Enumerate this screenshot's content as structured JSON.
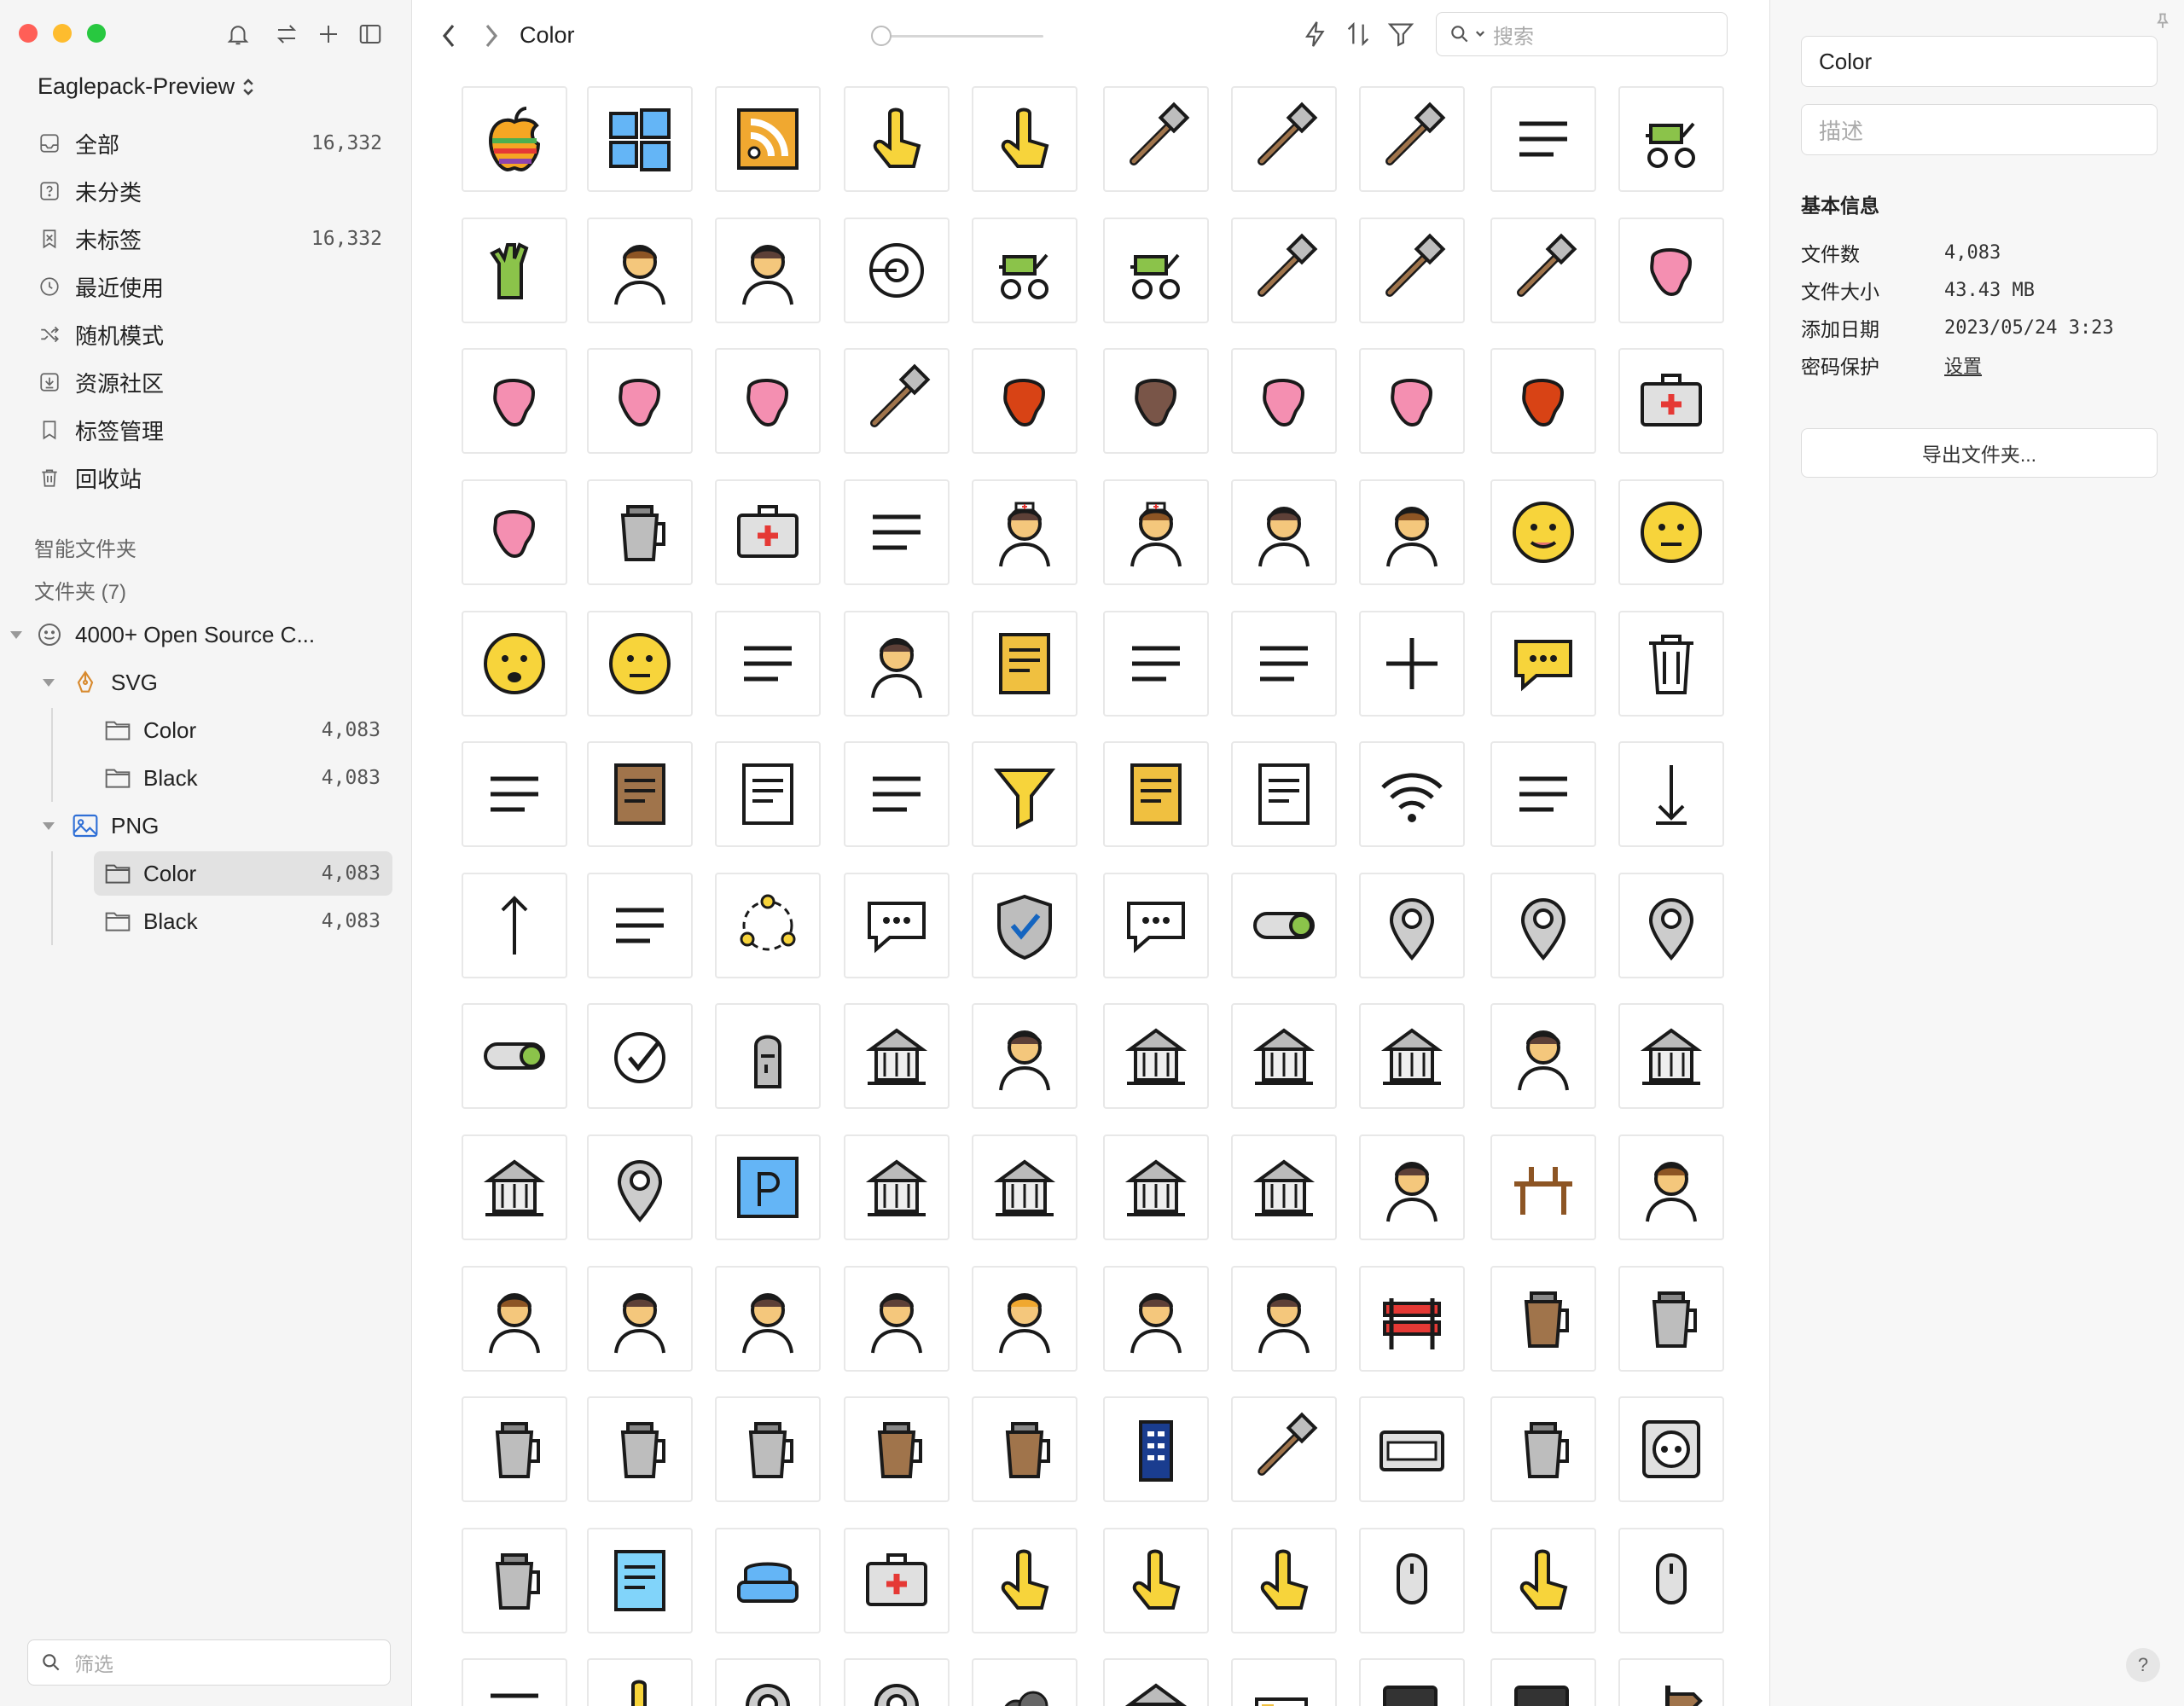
{
  "library": {
    "name": "Eaglepack-Preview"
  },
  "nav": [
    {
      "label": "全部",
      "count": "16,332",
      "icon": "inbox-icon"
    },
    {
      "label": "未分类",
      "count": "",
      "icon": "question-box-icon"
    },
    {
      "label": "未标签",
      "count": "16,332",
      "icon": "untagged-icon"
    },
    {
      "label": "最近使用",
      "count": "",
      "icon": "clock-icon"
    },
    {
      "label": "随机模式",
      "count": "",
      "icon": "shuffle-icon"
    },
    {
      "label": "资源社区",
      "count": "",
      "icon": "download-box-icon"
    },
    {
      "label": "标签管理",
      "count": "",
      "icon": "bookmark-icon"
    },
    {
      "label": "回收站",
      "count": "",
      "icon": "trash-icon"
    }
  ],
  "sections": {
    "smart_folders": "智能文件夹",
    "folders": "文件夹 (7)"
  },
  "tree": {
    "root": {
      "label": "4000+ Open Source C..."
    },
    "svg": {
      "label": "SVG",
      "children": [
        {
          "label": "Color",
          "count": "4,083"
        },
        {
          "label": "Black",
          "count": "4,083"
        }
      ]
    },
    "png": {
      "label": "PNG",
      "children": [
        {
          "label": "Color",
          "count": "4,083"
        },
        {
          "label": "Black",
          "count": "4,083"
        }
      ]
    }
  },
  "filter": {
    "placeholder": "筛选"
  },
  "toolbar": {
    "breadcrumb": "Color",
    "search_placeholder": "搜索"
  },
  "colors": {
    "accent": "#2f6fd6",
    "close": "#ff5f57",
    "minimize": "#febc2e",
    "zoom": "#28c840",
    "emoji_yellow": "#f7d43b",
    "skin": "#f4c77c"
  },
  "icons": [
    "apple-logo-icon",
    "windows-logo-icon",
    "rss-feed-icon",
    "no-handshake-icon",
    "hand-saw-icon",
    "axe-icon",
    "trowel-icon",
    "shovel-icon",
    "wheelbarrow-icon",
    "lawn-mower-icon",
    "gardening-gloves-icon",
    "woman-farmer-icon",
    "man-farmer-icon",
    "radiology-icon",
    "stretcher-icon",
    "wheelchair-icon",
    "crutches-icon",
    "scissors-icon",
    "thermometer-icon",
    "broken-bone-icon",
    "pelvis-pain-icon",
    "leg-pain-icon",
    "brain-icon",
    "tweezers-icon",
    "kidney-icon",
    "intestine-icon",
    "colon-icon",
    "stomach-icon",
    "liver-icon",
    "first-aid-kit-icon",
    "heartbeat-icon",
    "medicine-bottle-icon",
    "bandage-icon",
    "pill-blister-icon",
    "male-nurse-icon",
    "female-nurse-icon",
    "male-doctor-icon",
    "female-doctor-icon",
    "tongue-face-icon",
    "neutral-face-icon",
    "worried-face-icon",
    "confused-face-icon",
    "link-icon",
    "add-user-icon",
    "edit-document-icon",
    "sign-in-icon",
    "text-align-left-icon",
    "plus-icon",
    "speech-bubble-icon",
    "trash-can-icon",
    "list-icon",
    "inbox-tray-icon",
    "document-search-icon",
    "cursor-arrow-icon",
    "filter-funnel-icon",
    "address-book-icon",
    "new-page-icon",
    "wifi-icon",
    "share-icon",
    "arrow-down-icon",
    "arrow-up-icon",
    "menu-lines-icon",
    "people-network-icon",
    "chat-icon",
    "security-shield-icon",
    "conversation-icon",
    "toggle-on-icon",
    "route-icon",
    "ruler-scale-icon",
    "map-pin-icon",
    "toggle-off-icon",
    "check-circle-icon",
    "moai-icon",
    "museum-icon",
    "statue-seated-icon",
    "capitol-building-icon",
    "lighthouse-icon",
    "hanging-gardens-icon",
    "statue-icon",
    "town-hall-icon",
    "tower-icon",
    "folded-map-icon",
    "parking-sign-icon",
    "eiffel-tower-icon",
    "door-icon",
    "church-icon",
    "staircase-icon",
    "exit-person-icon",
    "restaurant-table-icon",
    "woman-long-hair-icon",
    "barista-woman-icon",
    "barista-man-icon",
    "barista-bun-icon",
    "horse-rider-icon",
    "politician-icon",
    "dog-walker-icon",
    "person-walking-icon",
    "road-barrier-icon",
    "coffee-grinder-icon",
    "coffee-machine-icon",
    "kettle-icon",
    "milk-jug-icon",
    "moka-pot-icon",
    "french-press-icon",
    "espresso-machine-icon",
    "police-box-icon",
    "broom-icon",
    "name-tag-icon",
    "lemon-squeezer-icon",
    "power-socket-icon",
    "candle-icon",
    "landscape-image-icon",
    "armchair-icon",
    "medical-bag-icon",
    "swipe-up-icon",
    "tap-gesture-icon",
    "file-swipe-icon",
    "mouse-scroll-icon",
    "pinch-gesture-icon",
    "mouse-vertical-icon",
    "selection-icon",
    "hand-icon",
    "target-pin-icon",
    "pin-icon",
    "smoke-icon",
    "house-icon",
    "battery-low-icon",
    "folder-monitor-icon",
    "info-device-icon",
    "signpost-icon"
  ],
  "details": {
    "name": "Color",
    "desc_placeholder": "描述",
    "info_title": "基本信息",
    "rows": [
      {
        "key": "文件数",
        "value": "4,083"
      },
      {
        "key": "文件大小",
        "value": "43.43 MB"
      },
      {
        "key": "添加日期",
        "value": "2023/05/24 3:23"
      },
      {
        "key": "密码保护",
        "value": "设置"
      }
    ],
    "export_label": "导出文件夹...",
    "help": "?"
  }
}
